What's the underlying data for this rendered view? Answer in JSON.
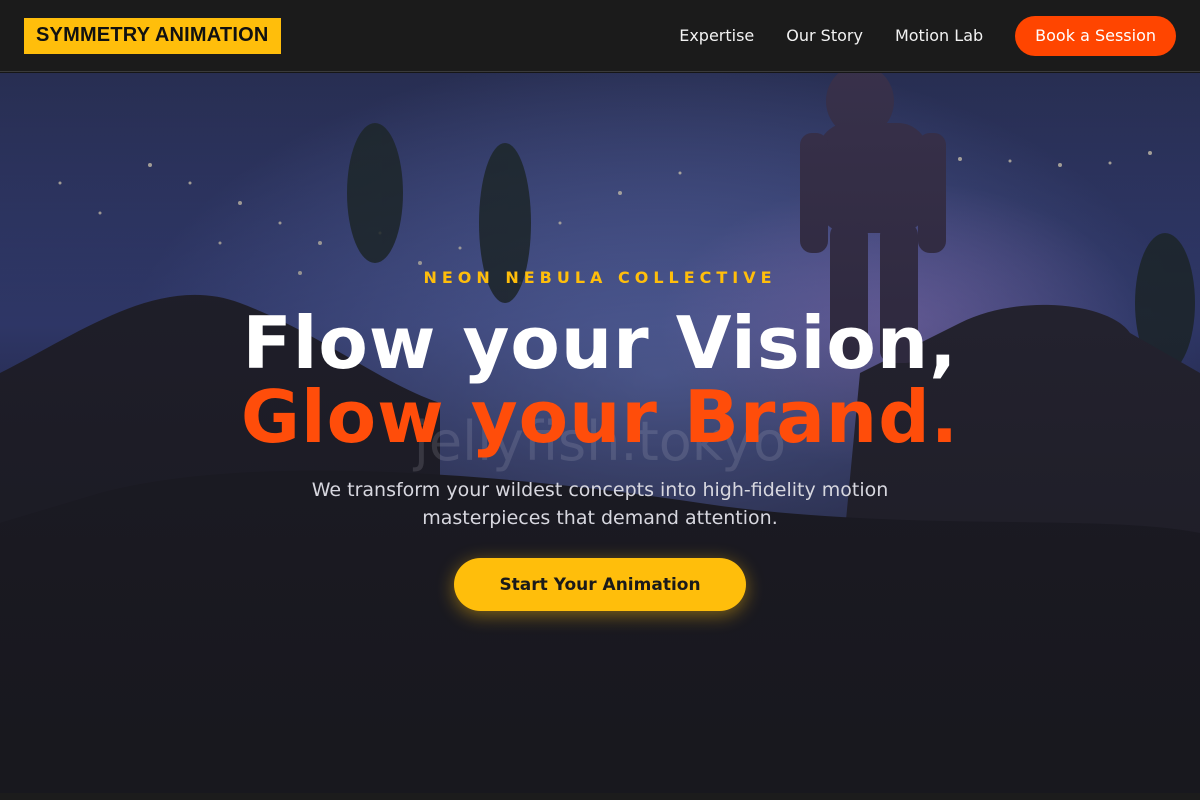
{
  "nav": {
    "logo": "SYMMETRY ANIMATION",
    "links": [
      "Expertise",
      "Our Story",
      "Motion Lab"
    ],
    "cta": "Book a Session"
  },
  "hero": {
    "eyebrow": "NEON NEBULA COLLECTIVE",
    "headline_line1": "Flow your Vision,",
    "headline_line2": "Glow your Brand.",
    "subtext": "We transform your wildest concepts into high-fidelity motion masterpieces that demand attention.",
    "cta": "Start Your Animation",
    "watermark": "jellyfish.tokyo"
  },
  "colors": {
    "accent_yellow": "#ffbe0b",
    "accent_orange": "#ff4500",
    "background": "#1b1b1b"
  }
}
